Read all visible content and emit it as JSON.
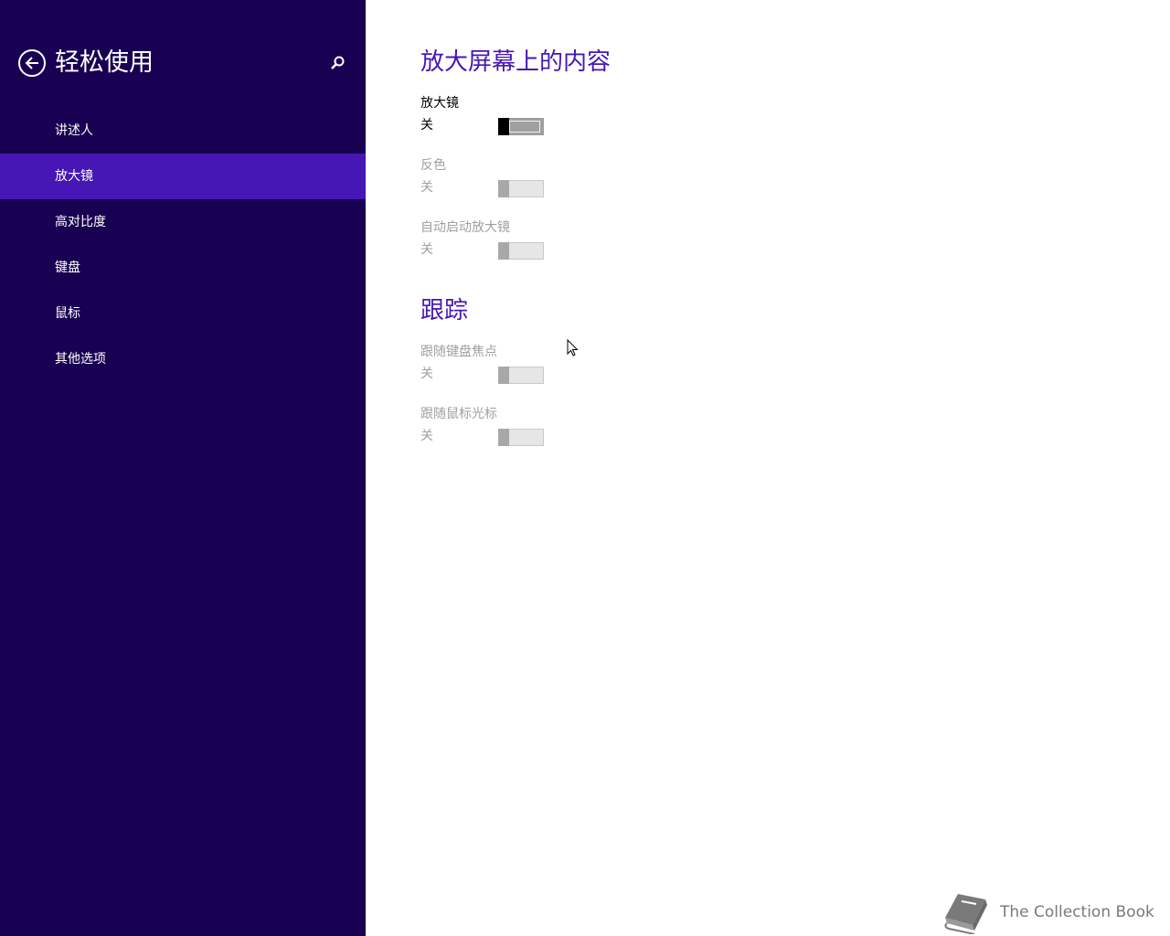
{
  "sidebar": {
    "title": "轻松使用",
    "items": [
      {
        "label": "讲述人"
      },
      {
        "label": "放大镜"
      },
      {
        "label": "高对比度"
      },
      {
        "label": "键盘"
      },
      {
        "label": "鼠标"
      },
      {
        "label": "其他选项"
      }
    ],
    "active_item": "放大镜",
    "background": "#180052",
    "active_background": "#4617b4"
  },
  "main": {
    "sections": [
      {
        "title": "放大屏幕上的内容",
        "settings": [
          {
            "label": "放大镜",
            "state": "关",
            "on": false,
            "enabled": true
          },
          {
            "label": "反色",
            "state": "关",
            "on": false,
            "enabled": false
          },
          {
            "label": "自动启动放大镜",
            "state": "关",
            "on": false,
            "enabled": false
          }
        ]
      },
      {
        "title": "跟踪",
        "settings": [
          {
            "label": "跟随键盘焦点",
            "state": "关",
            "on": false,
            "enabled": false
          },
          {
            "label": "跟随鼠标光标",
            "state": "关",
            "on": false,
            "enabled": false
          }
        ]
      }
    ],
    "accent_color": "#4617b4"
  },
  "watermark": {
    "text": "The Collection Book",
    "icon": "book-icon"
  }
}
